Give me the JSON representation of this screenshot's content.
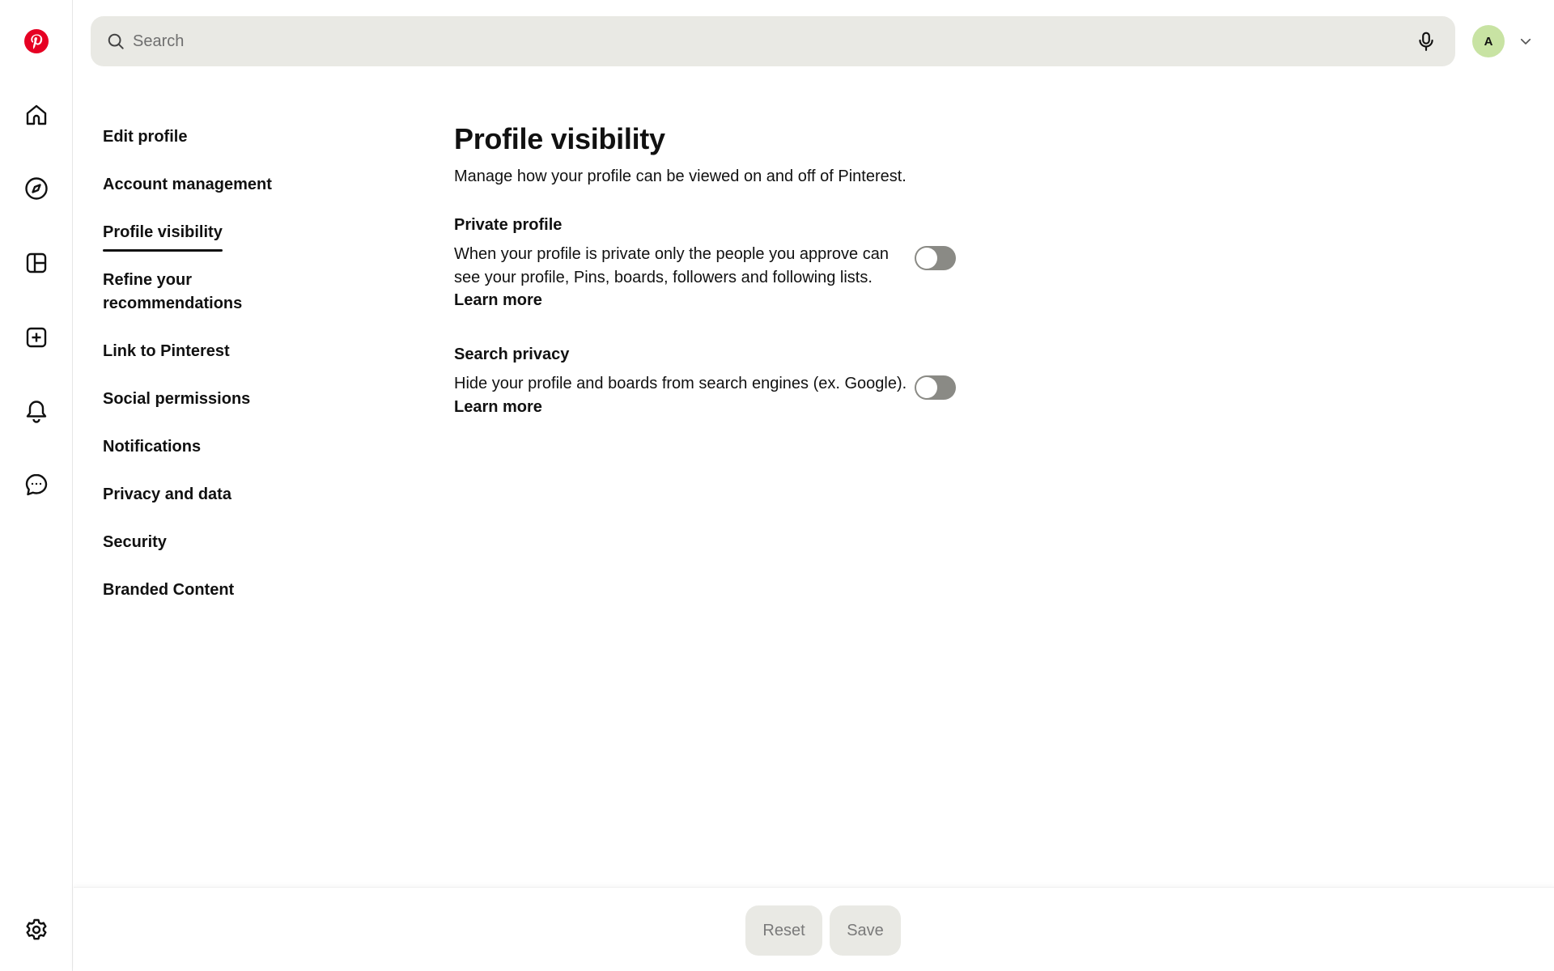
{
  "colors": {
    "brand": "#E60023",
    "search_bg": "#E9E9E4",
    "avatar_bg": "#C8E3A3",
    "toggle_off": "#8A8A85",
    "disabled_button_bg": "#E9E9E4",
    "disabled_button_text": "#7A7A7A"
  },
  "rail": {
    "items": [
      {
        "icon": "pinterest-logo"
      },
      {
        "icon": "home-icon"
      },
      {
        "icon": "explore-compass-icon"
      },
      {
        "icon": "boards-icon"
      },
      {
        "icon": "create-plus-icon"
      },
      {
        "icon": "notifications-bell-icon"
      },
      {
        "icon": "messages-icon"
      },
      {
        "icon": "settings-gear-icon"
      }
    ]
  },
  "search": {
    "placeholder": "Search",
    "value": ""
  },
  "account": {
    "avatar_initial": "A"
  },
  "settings_nav": {
    "items": [
      {
        "label": "Edit profile",
        "active": false
      },
      {
        "label": "Account management",
        "active": false
      },
      {
        "label": "Profile visibility",
        "active": true
      },
      {
        "label": "Refine your recommendations",
        "label_line1": "Refine your",
        "label_line2": "recommendations",
        "active": false
      },
      {
        "label": "Link to Pinterest",
        "active": false
      },
      {
        "label": "Social permissions",
        "active": false
      },
      {
        "label": "Notifications",
        "active": false
      },
      {
        "label": "Privacy and data",
        "active": false
      },
      {
        "label": "Security",
        "active": false
      },
      {
        "label": "Branded Content",
        "active": false
      }
    ]
  },
  "main": {
    "title": "Profile visibility",
    "subtitle": "Manage how your profile can be viewed on and off of Pinterest.",
    "sections": [
      {
        "title": "Private profile",
        "description": "When your profile is private only the people you approve can see your profile, Pins, boards, followers and following lists.",
        "link": "Learn more",
        "toggle_on": false
      },
      {
        "title": "Search privacy",
        "description": "Hide your profile and boards from search engines (ex. Google).",
        "link": "Learn more",
        "toggle_on": false
      }
    ]
  },
  "footer": {
    "reset_label": "Reset",
    "save_label": "Save"
  }
}
